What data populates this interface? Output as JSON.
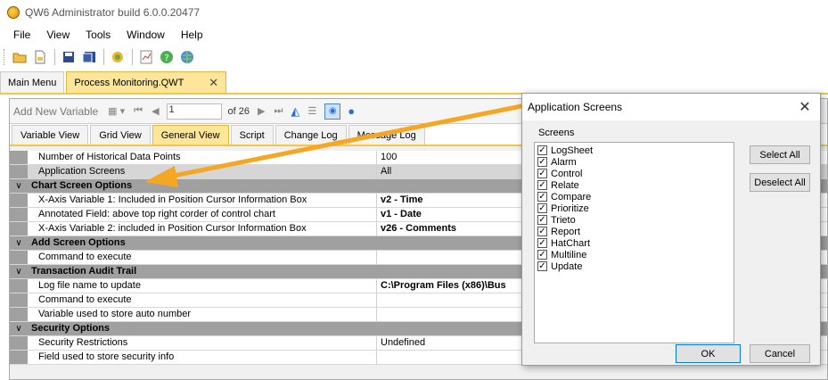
{
  "window": {
    "title": "QW6 Administrator build 6.0.0.20477"
  },
  "menu": [
    "File",
    "View",
    "Tools",
    "Window",
    "Help"
  ],
  "doc_tabs": [
    {
      "label": "Main Menu",
      "active": false
    },
    {
      "label": "Process Monitoring.QWT",
      "active": true,
      "close": "✕"
    }
  ],
  "navbar": {
    "add_label": "Add New Variable",
    "first": "⏮",
    "prev": "◀",
    "current": "1",
    "of": "of 26",
    "next": "▶",
    "last": "⏭"
  },
  "view_tabs": [
    "Variable View",
    "Grid View",
    "General View",
    "Script",
    "Change Log",
    "Message Log"
  ],
  "grid": {
    "r0": {
      "name": "Number of Historical Data Points",
      "value": "100"
    },
    "r1": {
      "name": "Application Screens",
      "value": "All"
    },
    "c1": "Chart Screen Options",
    "r2": {
      "name": "X-Axis Variable 1: Included in Position Cursor Information Box",
      "value": "v2 - Time"
    },
    "r3": {
      "name": "Annotated Field: above top right corder of control chart",
      "value": "v1 - Date"
    },
    "r4": {
      "name": "X-Axis Variable 2: included in Position Cursor Information Box",
      "value": "v26 - Comments"
    },
    "c2": "Add Screen Options",
    "r5": {
      "name": "Command to execute",
      "value": ""
    },
    "c3": "Transaction Audit Trail",
    "r6": {
      "name": "Log file name to update",
      "value": "C:\\Program Files (x86)\\Bus"
    },
    "r7": {
      "name": "Command to execute",
      "value": ""
    },
    "r8": {
      "name": "Variable used to store auto number",
      "value": ""
    },
    "c4": "Security Options",
    "r9": {
      "name": "Security Restrictions",
      "value": "Undefined"
    },
    "r10": {
      "name": "Field used to store security info",
      "value": ""
    }
  },
  "dialog": {
    "title": "Application Screens",
    "close": "✕",
    "list_label": "Screens",
    "screens": [
      "LogSheet",
      "Alarm",
      "Control",
      "Relate",
      "Compare",
      "Prioritize",
      "Trieto",
      "Report",
      "HatChart",
      "Multiline",
      "Update"
    ],
    "select_all": "Select All",
    "deselect_all": "Deselect All",
    "ok": "OK",
    "cancel": "Cancel"
  },
  "colors": {
    "accent_tab": "#fde69a",
    "tab_border": "#f2c842",
    "arrow": "#f5a623"
  }
}
